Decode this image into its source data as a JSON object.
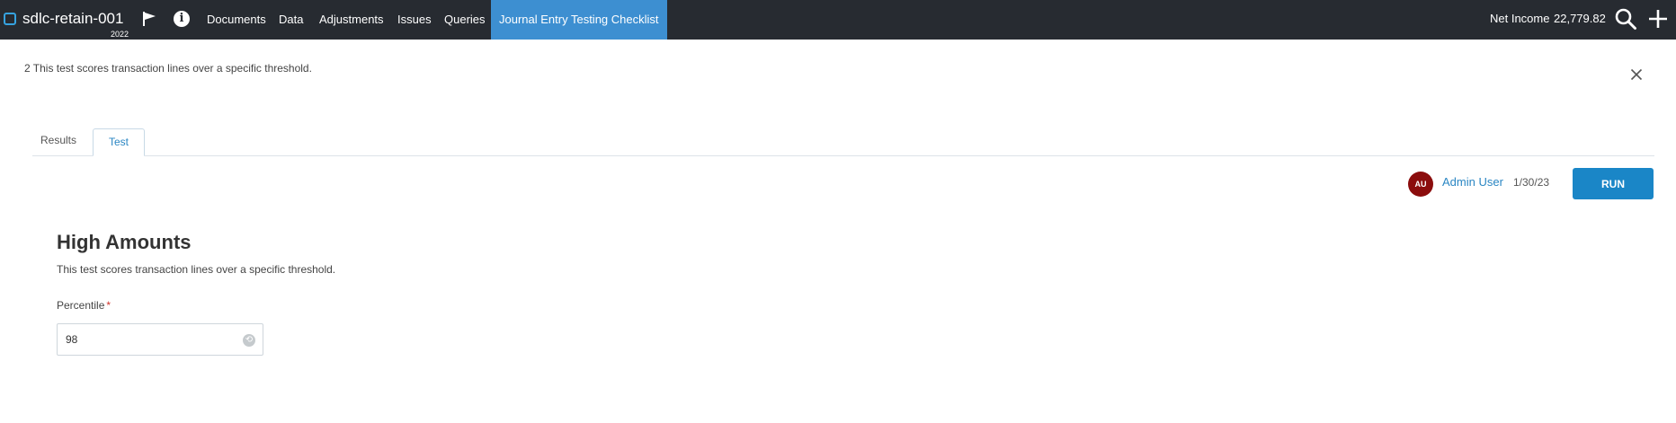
{
  "header": {
    "app_title": "sdlc-retain-001",
    "year": "2022",
    "nav": {
      "documents": "Documents",
      "data": "Data",
      "adjustments": "Adjustments",
      "issues": "Issues",
      "queries": "Queries",
      "checklist": "Journal Entry Testing Checklist"
    },
    "net_income_label": "Net Income",
    "net_income_value": "22,779.82",
    "icons": [
      "flag-icon",
      "info-icon",
      "search-icon",
      "plus-icon"
    ],
    "active_color": "#3d8fd1",
    "bar_color": "#272b31"
  },
  "banner": {
    "description": "2 This test scores transaction lines over a specific threshold."
  },
  "tabs": {
    "results": "Results",
    "test": "Test",
    "active": "Test"
  },
  "run_info": {
    "avatar_initials": "AU",
    "avatar_color": "#8b0d0d",
    "user_name": "Admin User",
    "date": "1/30/23",
    "run_label": "RUN",
    "run_color": "#1a86c7"
  },
  "test": {
    "title": "High Amounts",
    "description": "This test scores transaction lines over a specific threshold.",
    "percentile_label": "Percentile",
    "required_marker": "*",
    "percentile_value": "98"
  }
}
